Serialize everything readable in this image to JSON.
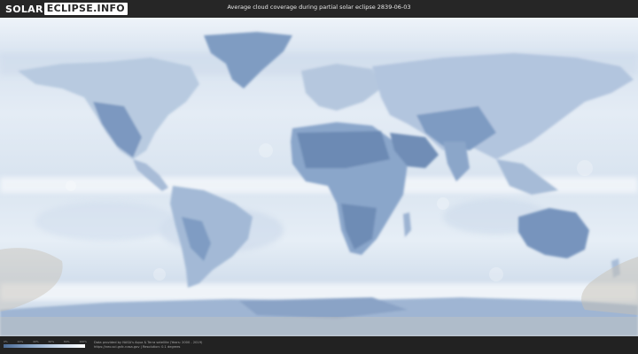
{
  "header": {
    "logo_left": "SOLAR",
    "logo_right": "ECLIPSE.INFO",
    "title": "Average cloud coverage during partial solar eclipse 2839-06-03"
  },
  "legend": {
    "ticks": [
      "0%",
      "20%",
      "40%",
      "60%",
      "80%",
      "100%"
    ],
    "gradient_colors": [
      "#4c6a94",
      "#8aa6c8",
      "#c9d8ea",
      "#ffffff"
    ]
  },
  "footer": {
    "credit_line1": "Data provided by NASA's Aqua & Terra satellite (Years: 2000 - 2019)",
    "credit_line2": "https://neo.sci.gsfc.nasa.gov | Resolution: 0.1 degrees"
  },
  "colors": {
    "land_dark": "#6e8cb4",
    "land_mid": "#94aed0",
    "cloud_light": "#dfe8f3",
    "background": "#2a2a2a"
  }
}
